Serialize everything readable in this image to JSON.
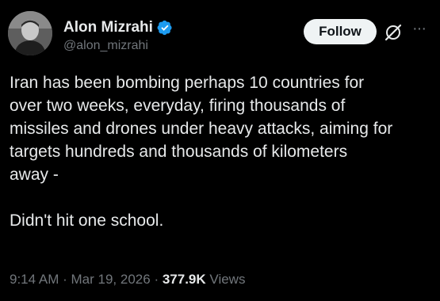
{
  "author": {
    "display_name": "Alon Mizrahi",
    "handle": "@alon_mizrahi",
    "verified_icon": "verified-badge-icon"
  },
  "actions": {
    "follow_label": "Follow",
    "grok_icon": "grok-icon",
    "more_label": "···"
  },
  "tweet": {
    "text": "Iran has been bombing perhaps 10 countries for\nover two weeks, everyday, firing thousands of\nmissiles and drones under heavy attacks, aiming for\ntargets hundreds and thousands of kilometers\naway -\n\nDidn't hit one school."
  },
  "meta": {
    "time": "9:14 AM",
    "separator": "·",
    "date": "Mar 19, 2026",
    "views_count": "377.9K",
    "views_label": "Views"
  },
  "colors": {
    "background": "#000000",
    "text": "#e7e9ea",
    "secondary": "#71767b",
    "verified": "#1d9bf0",
    "follow_bg": "#eff3f4"
  }
}
